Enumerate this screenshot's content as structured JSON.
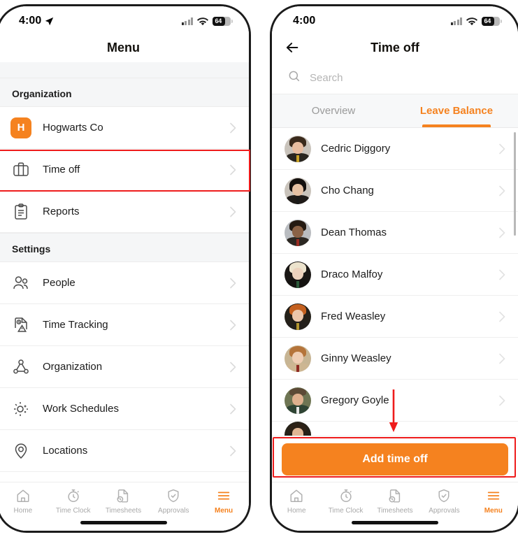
{
  "colors": {
    "accent": "#f5821f",
    "highlight": "#ee1c1c",
    "text": "#1b1b1b",
    "muted": "#9a9a9a"
  },
  "status_bar": {
    "time": "4:00",
    "battery_level": "64",
    "icons": [
      "location-arrow-icon",
      "cellular-signal-icon",
      "wifi-icon",
      "battery-icon"
    ]
  },
  "left_phone": {
    "navbar": {
      "title": "Menu"
    },
    "sections": [
      {
        "header": "Organization",
        "items": [
          {
            "label": "Hogwarts Co",
            "icon": "org-avatar-icon",
            "badge": "H"
          },
          {
            "label": "Time off",
            "icon": "suitcase-icon",
            "highlighted": true
          },
          {
            "label": "Reports",
            "icon": "clipboard-icon"
          }
        ]
      },
      {
        "header": "Settings",
        "items": [
          {
            "label": "People",
            "icon": "people-icon"
          },
          {
            "label": "Time Tracking",
            "icon": "time-tracking-icon"
          },
          {
            "label": "Organization",
            "icon": "org-chart-icon"
          },
          {
            "label": "Work Schedules",
            "icon": "sun-schedule-icon"
          },
          {
            "label": "Locations",
            "icon": "map-pin-icon"
          }
        ]
      }
    ],
    "tabbar": [
      {
        "label": "Home",
        "icon": "home-icon",
        "active": false
      },
      {
        "label": "Time Clock",
        "icon": "stopwatch-icon",
        "active": false
      },
      {
        "label": "Timesheets",
        "icon": "timesheet-icon",
        "active": false
      },
      {
        "label": "Approvals",
        "icon": "shield-check-icon",
        "active": false
      },
      {
        "label": "Menu",
        "icon": "hamburger-icon",
        "active": true
      }
    ]
  },
  "right_phone": {
    "navbar": {
      "title": "Time off",
      "back_icon": "back-arrow-icon"
    },
    "search": {
      "placeholder": "Search",
      "value": "",
      "icon": "search-icon"
    },
    "tabs": [
      {
        "label": "Overview",
        "active": false
      },
      {
        "label": "Leave Balance",
        "active": true
      }
    ],
    "people": [
      {
        "name": "Cedric Diggory",
        "hair": "#3a2a1c",
        "skin": "#e9c3a6",
        "robe": "#2a2620",
        "tie": "#c9a227"
      },
      {
        "name": "Cho Chang",
        "hair": "#14100e",
        "skin": "#e6c1a3",
        "robe": "#1f1b18",
        "tie": "#1a1a1a"
      },
      {
        "name": "Dean Thomas",
        "hair": "#241a12",
        "skin": "#8a6246",
        "robe": "#2b2722",
        "tie": "#9a2b22"
      },
      {
        "name": "Draco Malfoy",
        "hair": "#ece3cd",
        "skin": "#ecd2bd",
        "robe": "#151311",
        "tie": "#2c5a3a"
      },
      {
        "name": "Fred Weasley",
        "hair": "#c4601f",
        "skin": "#ecc6aa",
        "robe": "#231f1b",
        "tie": "#b4962f"
      },
      {
        "name": "Ginny Weasley",
        "hair": "#b5743a",
        "skin": "#efcdb3",
        "robe": "#cdb692",
        "tie": "#8f2a22"
      },
      {
        "name": "Gregory Goyle",
        "hair": "#5c4a36",
        "skin": "#dfb08e",
        "robe": "#2f4434",
        "tie": "#e8e8e8"
      },
      {
        "name": "",
        "hair": "#2d2116",
        "skin": "#e0b694",
        "robe": "#262118",
        "tie": "#6a6a6a"
      }
    ],
    "cta": {
      "label": "Add time off"
    },
    "tabbar": [
      {
        "label": "Home",
        "icon": "home-icon",
        "active": false
      },
      {
        "label": "Time Clock",
        "icon": "stopwatch-icon",
        "active": false
      },
      {
        "label": "Timesheets",
        "icon": "timesheet-icon",
        "active": false
      },
      {
        "label": "Approvals",
        "icon": "shield-check-icon",
        "active": false
      },
      {
        "label": "Menu",
        "icon": "hamburger-icon",
        "active": true
      }
    ]
  },
  "annotations": [
    {
      "type": "highlight-box",
      "target": "Time off menu row"
    },
    {
      "type": "arrow-down",
      "target": "Add time off button"
    },
    {
      "type": "highlight-box",
      "target": "Add time off button"
    }
  ]
}
